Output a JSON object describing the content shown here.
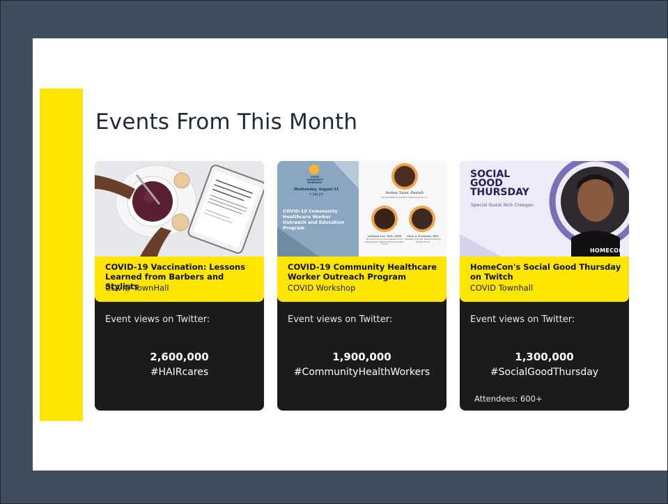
{
  "slide": {
    "title": "Events From This Month"
  },
  "colors": {
    "background": "#3f4e5d",
    "accent": "#ffe500",
    "card": "#1b1b1b"
  },
  "cards": [
    {
      "title": "COVID-19 Vaccination: Lessons Learned from Barbers and Stylists",
      "subtitle": "COVID TownHall",
      "views_label": "Event views on Twitter:",
      "views": "2,600,000",
      "hashtag": "#HAIRcares",
      "image": "coffee-and-tablet-photo"
    },
    {
      "title": "COVID-19 Community Healthcare Worker Outreach Program",
      "subtitle": "COVID Workshop",
      "views_label": "Event views on Twitter:",
      "views": "1,900,000",
      "hashtag": "#CommunityHealthWorkers",
      "image": "event-flyer",
      "flyer": {
        "logo_text": "COVID COMMUNITY WEBINARS",
        "date": "Wednesday, August 11",
        "time": "7 PM ET",
        "headline": "COVID-19 Community Healthcare Worker Outreach and Education Program",
        "speakers": [
          {
            "name": "Rodney Taylor, PharmD",
            "role": "Principal Medical Scientist, Gilead Sciences, Inc."
          },
          {
            "name": "LaTasha Lee, PhD, MPH",
            "role": "VP of Clinical and Social Research and Development, National Minority Quality Forum"
          },
          {
            "name": "Gary A. Puckrein, PhD",
            "role": "President and CEO, National Minority Quality Forum"
          }
        ]
      }
    },
    {
      "title": "HomeCon's Social Good Thursday on Twitch",
      "subtitle": "COVID Townhall",
      "views_label": "Event views on Twitter:",
      "views": "1,300,000",
      "hashtag": "#SocialGoodThursday",
      "attendees": "Attendees: 600+",
      "image": "social-good-thursday-banner",
      "banner": {
        "heading_1": "SOCIAL",
        "heading_2": "GOOD",
        "heading_3": "THURSDAY",
        "guest": "Special Guest Nick Creegan",
        "brand": "HOMECON"
      }
    }
  ]
}
